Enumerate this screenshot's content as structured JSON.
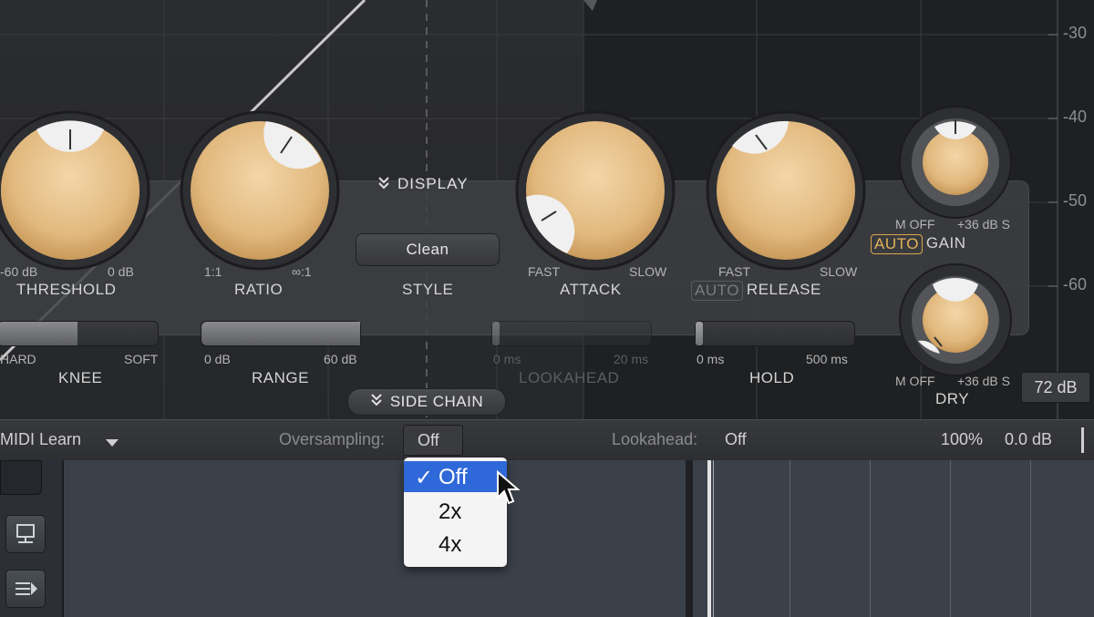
{
  "graph": {
    "db_labels": [
      "-30",
      "-40",
      "-50",
      "-60"
    ]
  },
  "display_toggle": {
    "label": "DISPLAY",
    "icon": "double-chevron-down-icon"
  },
  "knobs": {
    "threshold": {
      "label": "THRESHOLD",
      "min_label": "-60 dB",
      "max_label": "0 dB"
    },
    "ratio": {
      "label": "RATIO",
      "min_label": "1:1",
      "max_label": "∞:1"
    },
    "attack": {
      "label": "ATTACK",
      "min_label": "FAST",
      "max_label": "SLOW"
    },
    "release": {
      "label": "RELEASE",
      "auto_label": "AUTO",
      "min_label": "FAST",
      "max_label": "SLOW"
    },
    "gain": {
      "label": "GAIN",
      "auto_label": "AUTO",
      "min_label": "M OFF",
      "max_label": "+36 dB S"
    },
    "dry": {
      "label": "DRY",
      "min_label": "M OFF",
      "max_label": "+36 dB S"
    }
  },
  "style": {
    "button_label": "Clean",
    "label": "STYLE"
  },
  "sliders": {
    "knee": {
      "label": "KNEE",
      "min_label": "HARD",
      "max_label": "SOFT",
      "value_fraction": 0.5
    },
    "range": {
      "label": "RANGE",
      "min_label": "0 dB",
      "max_label": "60 dB",
      "value_fraction": 1.0
    },
    "lookahead": {
      "label": "LOOKAHEAD",
      "min_label": "0 ms",
      "max_label": "20 ms",
      "value_fraction": 0.0
    },
    "hold": {
      "label": "HOLD",
      "min_label": "0 ms",
      "max_label": "500 ms",
      "value_fraction": 0.0
    }
  },
  "range_readout": "72 dB",
  "side_chain": {
    "label": "SIDE CHAIN",
    "icon": "double-chevron-down-icon"
  },
  "status_bar": {
    "midi_learn": "MIDI Learn",
    "oversampling_label": "Oversampling:",
    "oversampling_value": "Off",
    "lookahead_label": "Lookahead:",
    "lookahead_value": "Off",
    "mix_value": "100%",
    "output_value": "0.0 dB"
  },
  "oversampling_menu": {
    "options": [
      "Off",
      "2x",
      "4x"
    ],
    "selected": "Off",
    "check_glyph": "✓"
  },
  "colors": {
    "knob_gold": "#e8c48f",
    "menu_highlight": "#2f68d8",
    "auto_accent": "#d9a64c"
  }
}
